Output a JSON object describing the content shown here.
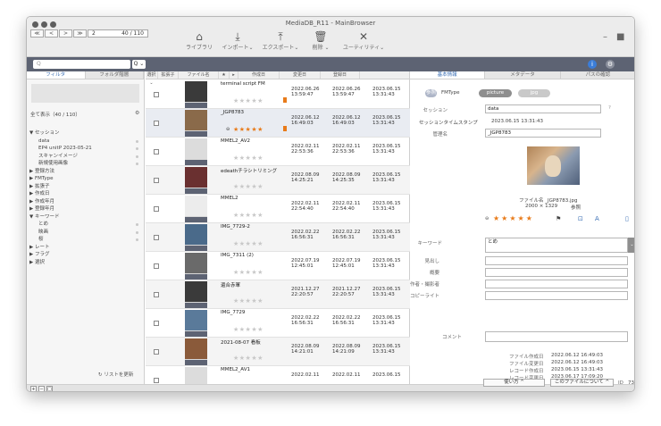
{
  "window": {
    "title": "MediaDB_R11 - MainBrowser",
    "page_input": "2",
    "page_total": "40 / 110"
  },
  "nav": {
    "first": "≪",
    "prev": "<",
    "next": ">",
    "last": "≫"
  },
  "toolbar": {
    "library": "ライブラリ",
    "import": "インポート⌄",
    "export": "エクスポート⌄",
    "delete": "削除 ⌄",
    "utility": "ユーティリティ⌄"
  },
  "search": {
    "placeholder": "Q",
    "dropdown": "Q ⌄"
  },
  "left": {
    "tab_filter": "フィルタ",
    "tab_folder": "フォルダ階層",
    "show_all": "全て表示（40 / 110）",
    "refresh": "リストを更新",
    "tree": [
      {
        "label": "▼ セッション",
        "indent": 0
      },
      {
        "label": "data",
        "indent": 1,
        "dot": true
      },
      {
        "label": "EP4 unitP 2023-05-21",
        "indent": 1,
        "dot": true
      },
      {
        "label": "スキャンイメージ",
        "indent": 1,
        "dot": true
      },
      {
        "label": "新規使用画像",
        "indent": 1,
        "dot": true
      },
      {
        "label": "▶ 登録方法",
        "indent": 0
      },
      {
        "label": "▶ FMType",
        "indent": 0
      },
      {
        "label": "▶ 拡張子",
        "indent": 0
      },
      {
        "label": "▶ 作成日",
        "indent": 0
      },
      {
        "label": "▶ 作成年月",
        "indent": 0
      },
      {
        "label": "▶ 登録年月",
        "indent": 0
      },
      {
        "label": "▼ キーワード",
        "indent": 0
      },
      {
        "label": "とめ",
        "indent": 1,
        "dot": true
      },
      {
        "label": "映画",
        "indent": 1,
        "dot": true
      },
      {
        "label": "桜",
        "indent": 1,
        "dot": true
      },
      {
        "label": "▶ レート",
        "indent": 0
      },
      {
        "label": "▶ フラグ",
        "indent": 0
      },
      {
        "label": "▶ 選択",
        "indent": 0
      }
    ]
  },
  "list": {
    "headers": [
      "選択 ⌄",
      "拡張子",
      "ファイル名",
      "★",
      "▸",
      "作成日",
      "変更日",
      "登録日"
    ],
    "rows": [
      {
        "name": "terminal script FM",
        "created": "2022.06.26\n13:59:47",
        "modified": "2022.06.26\n13:59:47",
        "registered": "2023.06.15\n13:31:43",
        "rated": false,
        "flag": true,
        "color": "#3a3a3a"
      },
      {
        "name": "_JGP8783",
        "created": "2022.06.12\n16:49:03",
        "modified": "2022.06.12\n16:49:03",
        "registered": "2023.06.15\n13:31:43",
        "rated": true,
        "flag": true,
        "color": "#8a6a4a",
        "selected": true
      },
      {
        "name": "MMEL2_AV2",
        "created": "2022.02.11\n22:53:36",
        "modified": "2022.02.11\n22:53:36",
        "registered": "2023.06.15\n13:31:43",
        "rated": false,
        "flag": false,
        "color": "#dcdcdc"
      },
      {
        "name": "edeathチラシトリミング",
        "created": "2022.08.09\n14:25:21",
        "modified": "2022.08.09\n14:25:35",
        "registered": "2023.06.15\n13:31:43",
        "rated": false,
        "flag": false,
        "color": "#6a3030"
      },
      {
        "name": "MMEL2",
        "created": "2022.02.11\n22:54:40",
        "modified": "2022.02.11\n22:54:40",
        "registered": "2023.06.15\n13:31:43",
        "rated": false,
        "flag": false,
        "color": "#ececec"
      },
      {
        "name": "IMG_7729-2",
        "created": "2022.02.22\n16:56:31",
        "modified": "2022.02.22\n16:56:31",
        "registered": "2023.06.15\n13:31:43",
        "rated": false,
        "flag": false,
        "color": "#4a6a8a"
      },
      {
        "name": "IMG_7311 (2)",
        "created": "2022.07.19\n12:45:01",
        "modified": "2022.07.19\n12:45:01",
        "registered": "2023.06.15\n13:31:43",
        "rated": false,
        "flag": false,
        "color": "#6a6a6a"
      },
      {
        "name": "還合赤軍",
        "created": "2021.12.27\n22:20:57",
        "modified": "2021.12.27\n22:20:57",
        "registered": "2023.06.15\n13:31:43",
        "rated": false,
        "flag": false,
        "color": "#3a3a3a"
      },
      {
        "name": "IMG_7729",
        "created": "2022.02.22\n16:56:31",
        "modified": "2022.02.22\n16:56:31",
        "registered": "2023.06.15\n13:31:43",
        "rated": false,
        "flag": false,
        "color": "#5a7a9a"
      },
      {
        "name": "2021-08-07 看板",
        "created": "2022.08.09\n14:21:01",
        "modified": "2022.08.09\n14:21:09",
        "registered": "2023.06.15\n13:31:43",
        "rated": false,
        "flag": false,
        "color": "#8a5a3a"
      },
      {
        "name": "MMEL2_AV1",
        "created": "2022.02.11",
        "modified": "2022.02.11",
        "registered": "2023.06.15",
        "rated": false,
        "flag": false,
        "color": "#dcdcdc"
      }
    ]
  },
  "right": {
    "tab_basic": "基本情報",
    "tab_meta": "メタデータ",
    "tab_path": "パスの確認",
    "pill_ref": "参照",
    "fmtype_label": "FMType",
    "fmtype": "picture",
    "ext": "jpg",
    "session_label": "セッション",
    "session_value": "data",
    "timestamp_label": "セッションタイムスタンプ",
    "timestamp_value": "2023.06.15 13:31:43",
    "mgmt_label": "管理名",
    "mgmt_value": "_JGP8783",
    "filename": "ファイル名 _JGP8783.jpg",
    "dimensions": "2000 × 1329",
    "ref": "参照",
    "keyword_label": "キーワード",
    "keyword_value": "とめ",
    "heading_label": "見出し",
    "summary_label": "概要",
    "author_label": "作者・撮影者",
    "copyright_label": "コピーライト",
    "comment_label": "コメント",
    "info": [
      {
        "label": "ファイル作成日",
        "value": "2022.06.12 16:49:03"
      },
      {
        "label": "ファイル変更日",
        "value": "2022.06.12 16:49:03"
      },
      {
        "label": "レコード作成日",
        "value": "2023.06.15 13:31:43"
      },
      {
        "label": "レコード変更日",
        "value": "2023.06.17 17:09:20"
      }
    ],
    "id_label": "ID",
    "id_value": "73",
    "usage_button": "使い方 ^",
    "about_button": "このファイルについて ^"
  },
  "colors": {
    "accent": "#e87b1a",
    "header": "#5d6373",
    "tab_active": "#3b6fb5"
  }
}
